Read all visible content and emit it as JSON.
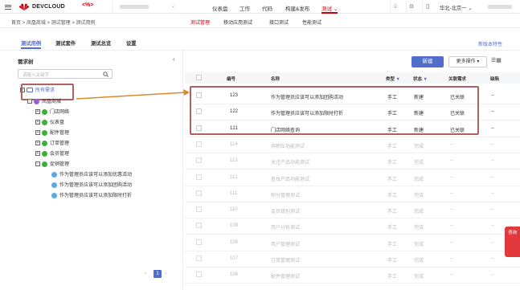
{
  "brand": "DEVCLOUD",
  "code_icon": "<%>",
  "top_nav": [
    "仪表盘",
    "工作",
    "代码",
    "构建&发布",
    "测试"
  ],
  "top_nav_active": "测试",
  "region": "华北-北京一",
  "breadcrumb": "首页 > 凤凰商城 > 测试管理 > 测试用例",
  "sub_tabs": [
    "测试管理",
    "移动应用测试",
    "接口测试",
    "性能测试"
  ],
  "feature_tabs": [
    "测试用例",
    "测试套件",
    "测试总览",
    "设置"
  ],
  "new_feature_link": "新版本特性",
  "sidebar": {
    "title": "需求树",
    "search_placeholder": "请输入关键字",
    "tree": [
      {
        "label": "所有需求",
        "level": 0
      },
      {
        "label": "凤凰商城",
        "level": 1
      },
      {
        "label": "门店网络",
        "level": 2
      },
      {
        "label": "仪表盘",
        "level": 2
      },
      {
        "label": "配件管理",
        "level": 2
      },
      {
        "label": "订单管理",
        "level": 2
      },
      {
        "label": "会员管理",
        "level": 2
      },
      {
        "label": "促销管理",
        "level": 2
      },
      {
        "label": "作为管理员应该可以添加优惠活动",
        "level": 3
      },
      {
        "label": "作为管理员应该可以添加团购活动",
        "level": 3
      },
      {
        "label": "作为管理员应该可以添加限时打折",
        "level": 3
      }
    ],
    "page": "1"
  },
  "toolbar": {
    "new_label": "新建",
    "more_label": "更多操作"
  },
  "table": {
    "headers": [
      "编号",
      "名称",
      "类型",
      "状态",
      "关联需求",
      "缺陷"
    ],
    "rows": [
      {
        "id": "123",
        "name": "作为管理员应该可以添加团购活动",
        "type": "手工",
        "status": "新建",
        "linked": "已关联",
        "defect": "--",
        "dim": false
      },
      {
        "id": "122",
        "name": "作为管理员应该可以添加限时打折",
        "type": "手工",
        "status": "新建",
        "linked": "已关联",
        "defect": "--",
        "dim": false
      },
      {
        "id": "121",
        "name": "门店网络查询",
        "type": "手工",
        "status": "新建",
        "linked": "已关联",
        "defect": "--",
        "dim": false
      },
      {
        "id": "114",
        "name": "购物车功能测试",
        "type": "手工",
        "status": "完成",
        "linked": "--",
        "defect": "--",
        "dim": true
      },
      {
        "id": "113",
        "name": "关注产品功能测试",
        "type": "手工",
        "status": "完成",
        "linked": "--",
        "defect": "--",
        "dim": true
      },
      {
        "id": "112",
        "name": "查找产品功能测试",
        "type": "手工",
        "status": "完成",
        "linked": "--",
        "defect": "--",
        "dim": true
      },
      {
        "id": "111",
        "name": "积分管理测试",
        "type": "手工",
        "status": "完成",
        "linked": "--",
        "defect": "--",
        "dim": true
      },
      {
        "id": "110",
        "name": "会员级别测试",
        "type": "手工",
        "status": "完成",
        "linked": "--",
        "defect": "--",
        "dim": true
      },
      {
        "id": "109",
        "name": "用户分析测试",
        "type": "手工",
        "status": "完成",
        "linked": "--",
        "defect": "--",
        "dim": true
      },
      {
        "id": "108",
        "name": "用户管理测试",
        "type": "手工",
        "status": "完成",
        "linked": "--",
        "defect": "--",
        "dim": true
      },
      {
        "id": "107",
        "name": "订单管理测试",
        "type": "手工",
        "status": "完成",
        "linked": "--",
        "defect": "--",
        "dim": true
      },
      {
        "id": "106",
        "name": "配件管理测试",
        "type": "手工",
        "status": "完成",
        "linked": "--",
        "defect": "--",
        "dim": true
      }
    ]
  },
  "fab_label": "咨询",
  "colors": {
    "accent": "#526ecc",
    "brand": "#c7000b",
    "highlight": "#b06060",
    "arrow": "#d98a2c"
  }
}
